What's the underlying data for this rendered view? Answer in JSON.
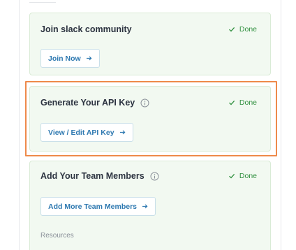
{
  "steps": [
    {
      "title": "Join slack community",
      "status": "Done",
      "button_label": "Join Now",
      "has_info": false
    },
    {
      "title": "Generate Your API Key",
      "status": "Done",
      "button_label": "View / Edit API Key",
      "has_info": true
    },
    {
      "title": "Add Your Team Members",
      "status": "Done",
      "button_label": "Add More Team Members",
      "has_info": true
    }
  ],
  "resources_label": "Resources",
  "colors": {
    "card_bg": "#f2f9f1",
    "done_green": "#2f8f3e",
    "button_text": "#2d78b0",
    "highlight": "#ee8a4a"
  },
  "icons": {
    "done": "check-icon",
    "info": "info-icon",
    "button": "arrow-right-icon"
  }
}
